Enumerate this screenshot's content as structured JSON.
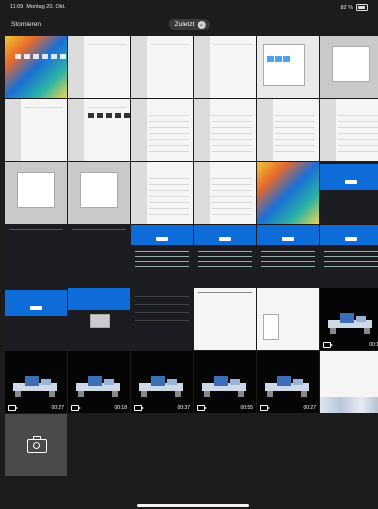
{
  "status_bar": {
    "time": "11:09",
    "date": "Montag 20. Okt.",
    "battery": "82 %"
  },
  "nav": {
    "cancel": "Stornieren",
    "album": "Zuletzt"
  },
  "grid": {
    "columns": 6,
    "rows": [
      [
        {
          "kind": "wallpaper"
        },
        {
          "kind": "settings-white"
        },
        {
          "kind": "settings-white"
        },
        {
          "kind": "settings-white"
        },
        {
          "kind": "files-dialog"
        },
        {
          "kind": "settings-gray"
        }
      ],
      [
        {
          "kind": "settings-white"
        },
        {
          "kind": "settings-icons"
        },
        {
          "kind": "settings-list"
        },
        {
          "kind": "settings-list"
        },
        {
          "kind": "settings-list"
        },
        {
          "kind": "settings-list"
        }
      ],
      [
        {
          "kind": "settings-gray"
        },
        {
          "kind": "settings-gray"
        },
        {
          "kind": "settings-list"
        },
        {
          "kind": "settings-list"
        },
        {
          "kind": "wallpaper-frame"
        },
        {
          "kind": "blue-banner"
        }
      ],
      [
        {
          "kind": "dark-app"
        },
        {
          "kind": "dark-app"
        },
        {
          "kind": "blue-list"
        },
        {
          "kind": "blue-list"
        },
        {
          "kind": "blue-list"
        },
        {
          "kind": "blue-list"
        }
      ],
      [
        {
          "kind": "blue-banner"
        },
        {
          "kind": "blue-dialog"
        },
        {
          "kind": "dark-menu"
        },
        {
          "kind": "white-doc"
        },
        {
          "kind": "white-popup"
        },
        {
          "kind": "video",
          "duration": "00:1"
        }
      ],
      [
        {
          "kind": "video",
          "duration": "00:27"
        },
        {
          "kind": "video",
          "duration": "00:18"
        },
        {
          "kind": "video",
          "duration": "00:37"
        },
        {
          "kind": "video",
          "duration": "00:55"
        },
        {
          "kind": "video",
          "duration": "00:27"
        },
        {
          "kind": "photo-strip"
        }
      ]
    ]
  },
  "camera_tile": {
    "icon": "camera-icon"
  },
  "colors": {
    "background": "#1c1c1e",
    "accent_blue": "#0d6cd8",
    "pill": "#3a3a3c"
  }
}
